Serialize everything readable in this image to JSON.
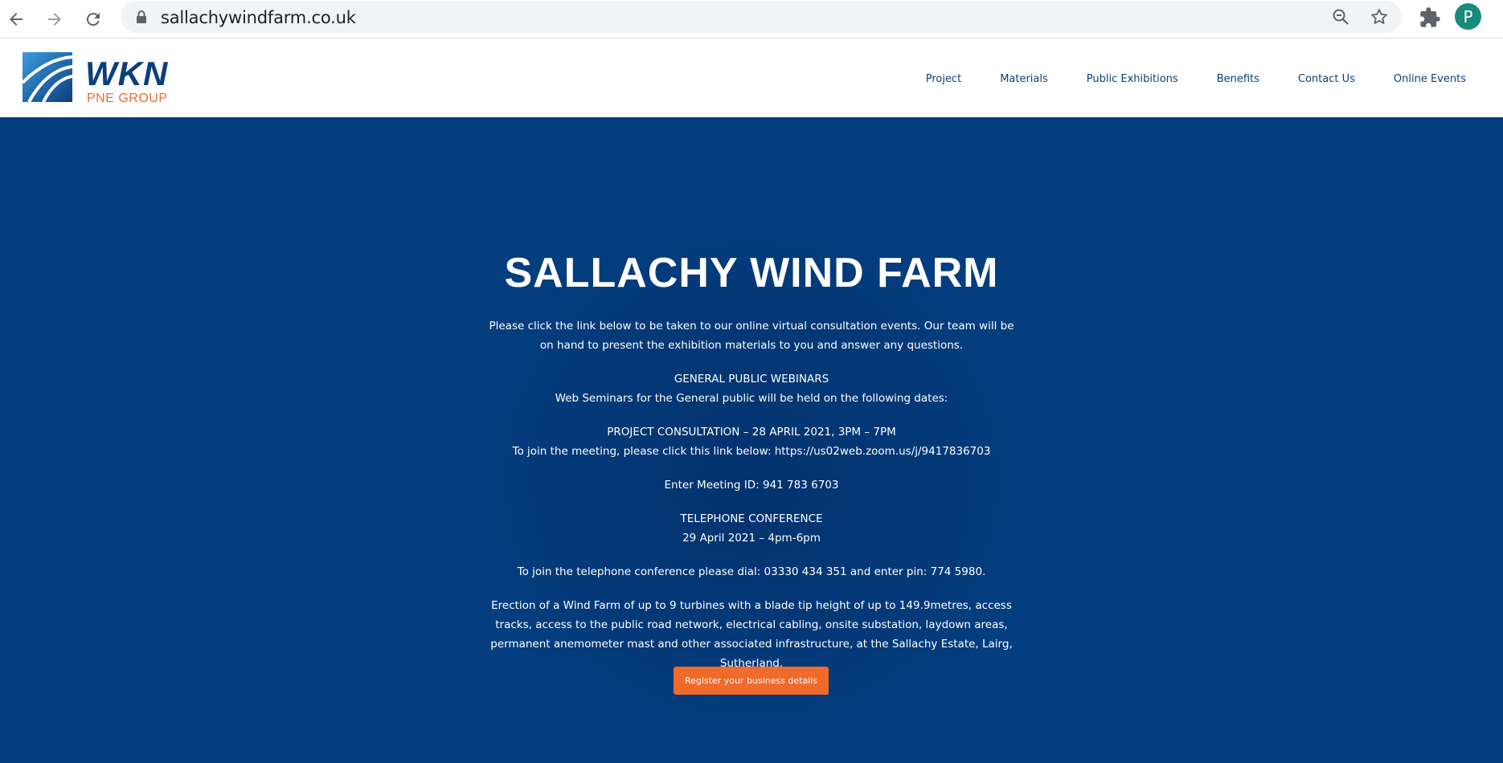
{
  "browser": {
    "url": "sallachywindfarm.co.uk",
    "profile_initial": "P"
  },
  "logo": {
    "name": "WKN",
    "sub": "PNE GROUP"
  },
  "nav": {
    "items": [
      "Project",
      "Materials",
      "Public Exhibitions",
      "Benefits",
      "Contact Us",
      "Online Events"
    ]
  },
  "hero": {
    "title": "SALLACHY WIND FARM",
    "intro": "Please click the link below to be taken to our online virtual consultation events. Our team will be on hand to present the exhibition materials to you and answer any questions.",
    "webinars_heading": "GENERAL PUBLIC WEBINARS",
    "webinars_text": "Web Seminars for the General public will be held on the following dates:",
    "consultation_heading": "PROJECT CONSULTATION – 28 APRIL 2021, 3PM – 7PM",
    "consultation_link_text": "To join the meeting, please click this link below: https://us02web.zoom.us/j/9417836703",
    "meeting_id": "Enter Meeting ID: 941 783 6703",
    "telephone_heading": "TELEPHONE CONFERENCE",
    "telephone_date": "29 April 2021 – 4pm-6pm",
    "telephone_dial": "To join the telephone conference please dial: 03330 434 351 and enter pin: 774 5980.",
    "description": "Erection of a Wind Farm of up to 9 turbines with a blade tip height of up to 149.9metres, access tracks, access to the public road network, electrical cabling, onsite substation, laydown areas, permanent anemometer mast and other associated infrastructure, at the Sallachy Estate, Lairg, Sutherland.",
    "cta_label": "Register your business details"
  },
  "colors": {
    "hero_bg": "#043e7f",
    "brand_blue": "#0b3f7c",
    "accent_orange": "#ef6a2b"
  }
}
